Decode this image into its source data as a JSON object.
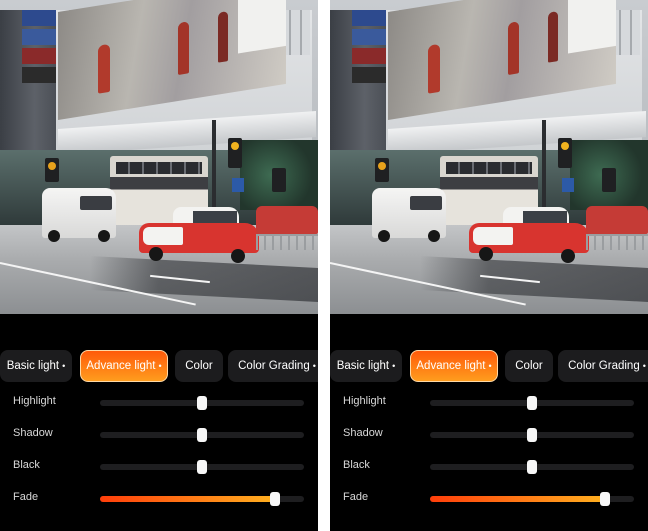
{
  "panels": [
    {
      "id": "left",
      "tabs": [
        {
          "label": "Basic light",
          "dot": "•",
          "active": false
        },
        {
          "label": "Advance light",
          "dot": "•",
          "active": true
        },
        {
          "label": "Color",
          "dot": "",
          "active": false
        },
        {
          "label": "Color Grading",
          "dot": "•",
          "active": false
        }
      ],
      "sliders": [
        {
          "label": "Highlight",
          "value": 0.5,
          "filled": false
        },
        {
          "label": "Shadow",
          "value": 0.5,
          "filled": false
        },
        {
          "label": "Black",
          "value": 0.5,
          "filled": false
        },
        {
          "label": "Fade",
          "value": 0.86,
          "filled": true
        }
      ]
    },
    {
      "id": "right",
      "tabs": [
        {
          "label": "Basic light",
          "dot": "•",
          "active": false
        },
        {
          "label": "Advance light",
          "dot": "•",
          "active": true
        },
        {
          "label": "Color",
          "dot": "",
          "active": false
        },
        {
          "label": "Color Grading",
          "dot": "•",
          "active": false
        }
      ],
      "sliders": [
        {
          "label": "Highlight",
          "value": 0.5,
          "filled": false
        },
        {
          "label": "Shadow",
          "value": 0.5,
          "filled": false
        },
        {
          "label": "Black",
          "value": 0.5,
          "filled": false
        },
        {
          "label": "Fade",
          "value": 0.86,
          "filled": true
        }
      ]
    }
  ],
  "colors": {
    "accent_start": "#ff3e0a",
    "accent_end": "#ffb020",
    "background": "#000000",
    "tab_background": "#1c1c1e"
  }
}
